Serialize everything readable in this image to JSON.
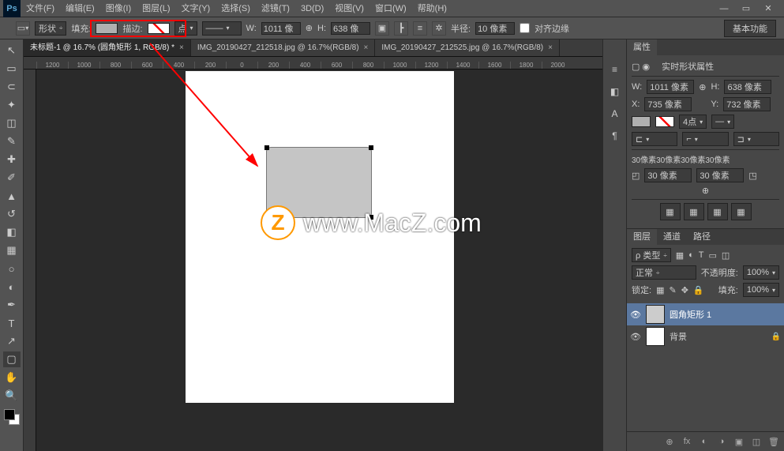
{
  "menubar": [
    "文件(F)",
    "编辑(E)",
    "图像(I)",
    "图层(L)",
    "文字(Y)",
    "选择(S)",
    "滤镜(T)",
    "3D(D)",
    "视图(V)",
    "窗口(W)",
    "帮助(H)"
  ],
  "optionsbar": {
    "shape_mode": "形状",
    "fill_label": "填充:",
    "stroke_label": "描边:",
    "stroke_width": "点",
    "w_label": "W:",
    "w_value": "1011 像",
    "h_label": "H:",
    "h_value": "638 像",
    "radius_label": "半径:",
    "radius_value": "10 像素",
    "align_edges": "对齐边缘",
    "workspace": "基本功能"
  },
  "tabs": [
    {
      "label": "未标题-1 @ 16.7% (圆角矩形 1, RGB/8) *",
      "active": true
    },
    {
      "label": "IMG_20190427_212518.jpg @ 16.7%(RGB/8)",
      "active": false
    },
    {
      "label": "IMG_20190427_212525.jpg @ 16.7%(RGB/8)",
      "active": false
    }
  ],
  "ruler_ticks": [
    "1200",
    "1000",
    "800",
    "600",
    "400",
    "200",
    "0",
    "200",
    "400",
    "600",
    "800",
    "1000",
    "1200",
    "1400",
    "1600",
    "1800",
    "2000"
  ],
  "properties": {
    "panel_title": "属性",
    "title": "实时形状属性",
    "w_label": "W:",
    "w_val": "1011 像素",
    "h_label": "H:",
    "h_val": "638 像素",
    "x_label": "X:",
    "x_val": "735 像素",
    "y_label": "Y:",
    "y_val": "732 像素",
    "stroke_pt": "4点",
    "corner_desc": "30像素30像素30像素30像素",
    "corner_val": "30 像素"
  },
  "layers_panel": {
    "tabs": [
      "图层",
      "通道",
      "路径"
    ],
    "kind": "ρ 类型",
    "blend": "正常",
    "opacity_label": "不透明度:",
    "opacity": "100%",
    "lock_label": "锁定:",
    "fill_label": "填充:",
    "fill": "100%",
    "layers": [
      {
        "name": "圆角矩形 1",
        "selected": true
      },
      {
        "name": "背景",
        "selected": false,
        "locked": true
      }
    ]
  },
  "watermark": "www.MacZ.com"
}
